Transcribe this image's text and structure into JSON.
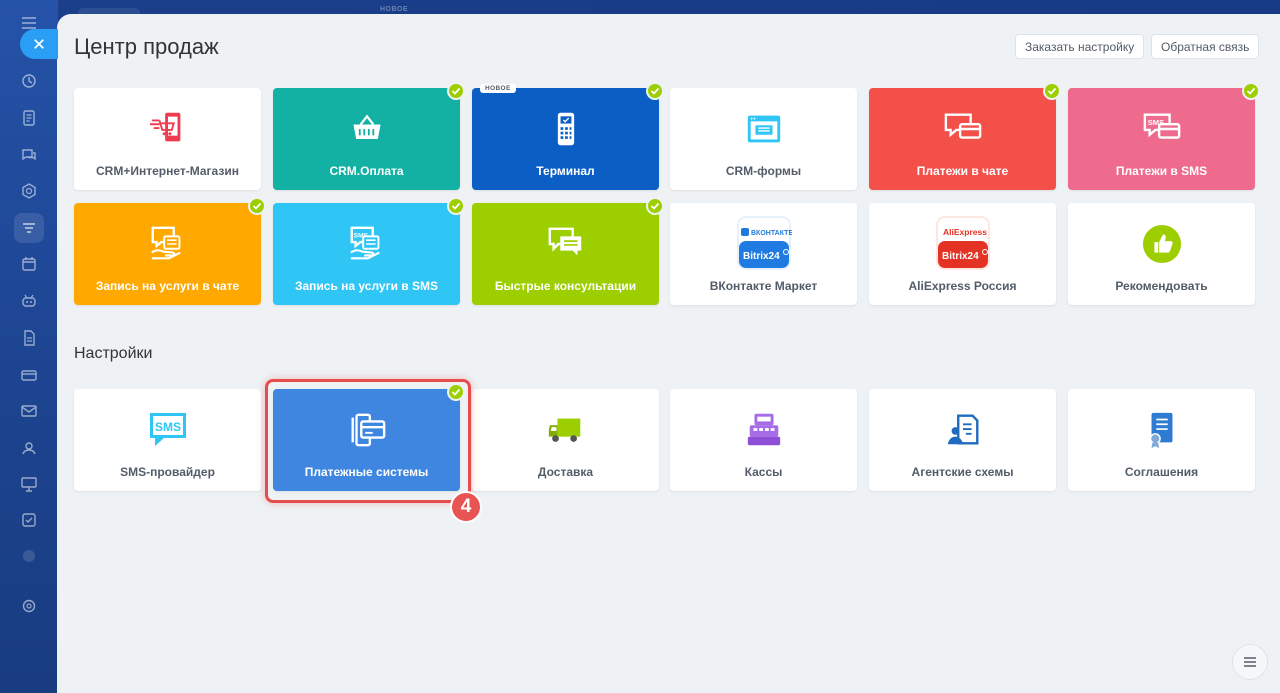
{
  "header": {
    "title": "Центр продаж",
    "order_setup_label": "Заказать настройку",
    "feedback_label": "Обратная связь",
    "ghost_badge": "НОВОЕ"
  },
  "tiles_top": [
    {
      "label": "CRM+Интернет-Магазин",
      "color": "#ffffff",
      "icon": "shop-phone-icon",
      "checked": false
    },
    {
      "label": "CRM.Оплата",
      "color": "#12b1a3",
      "icon": "basket-icon",
      "checked": true
    },
    {
      "label": "Терминал",
      "color": "#0b5fc4",
      "icon": "terminal-icon",
      "checked": true,
      "badge": "НОВОЕ"
    },
    {
      "label": "CRM-формы",
      "color": "#ffffff",
      "icon": "form-window-icon",
      "checked": false
    },
    {
      "label": "Платежи в чате",
      "color": "#f4504a",
      "icon": "chat-card-icon",
      "checked": true
    },
    {
      "label": "Платежи в SMS",
      "color": "#ee6b8e",
      "icon": "sms-card-icon",
      "checked": true
    }
  ],
  "tiles_mid": [
    {
      "label": "Запись на услуги в чате",
      "color": "#ffa900",
      "icon": "chat-booking-icon",
      "checked": true
    },
    {
      "label": "Запись на услуги в SMS",
      "color": "#2fc6f6",
      "icon": "sms-booking-icon",
      "checked": true
    },
    {
      "label": "Быстрые консультации",
      "color": "#9dcf00",
      "icon": "chat-consult-icon",
      "checked": true
    },
    {
      "label": "ВКонтакте Маркет",
      "color": "#ffffff",
      "icon": "vk-bitrix-icon",
      "checked": false,
      "logo_top": "ВКОНТАКТЕ",
      "logo_bottom": "Bitrix24"
    },
    {
      "label": "AliExpress Россия",
      "color": "#ffffff",
      "icon": "aliexpress-bitrix-icon",
      "checked": false,
      "logo_top": "AliExpress",
      "logo_bottom": "Bitrix24"
    },
    {
      "label": "Рекомендовать",
      "color": "#ffffff",
      "icon": "thumbs-up-icon",
      "checked": false
    }
  ],
  "settings": {
    "title": "Настройки",
    "tiles": [
      {
        "label": "SMS-провайдер",
        "color": "#ffffff",
        "icon": "sms-provider-icon",
        "icon_text": "SMS",
        "checked": false
      },
      {
        "label": "Платежные системы",
        "color": "#3f86e0",
        "icon": "payment-systems-icon",
        "checked": true
      },
      {
        "label": "Доставка",
        "color": "#ffffff",
        "icon": "truck-icon",
        "checked": false
      },
      {
        "label": "Кассы",
        "color": "#ffffff",
        "icon": "cash-register-icon",
        "checked": false
      },
      {
        "label": "Агентские схемы",
        "color": "#ffffff",
        "icon": "agent-schemes-icon",
        "checked": false
      },
      {
        "label": "Соглашения",
        "color": "#ffffff",
        "icon": "agreements-icon",
        "checked": false
      }
    ]
  },
  "step_badge": "4",
  "colors": {
    "check": "#9dcf00",
    "highlight": "#e74c4c",
    "accent": "#2a9df4"
  }
}
